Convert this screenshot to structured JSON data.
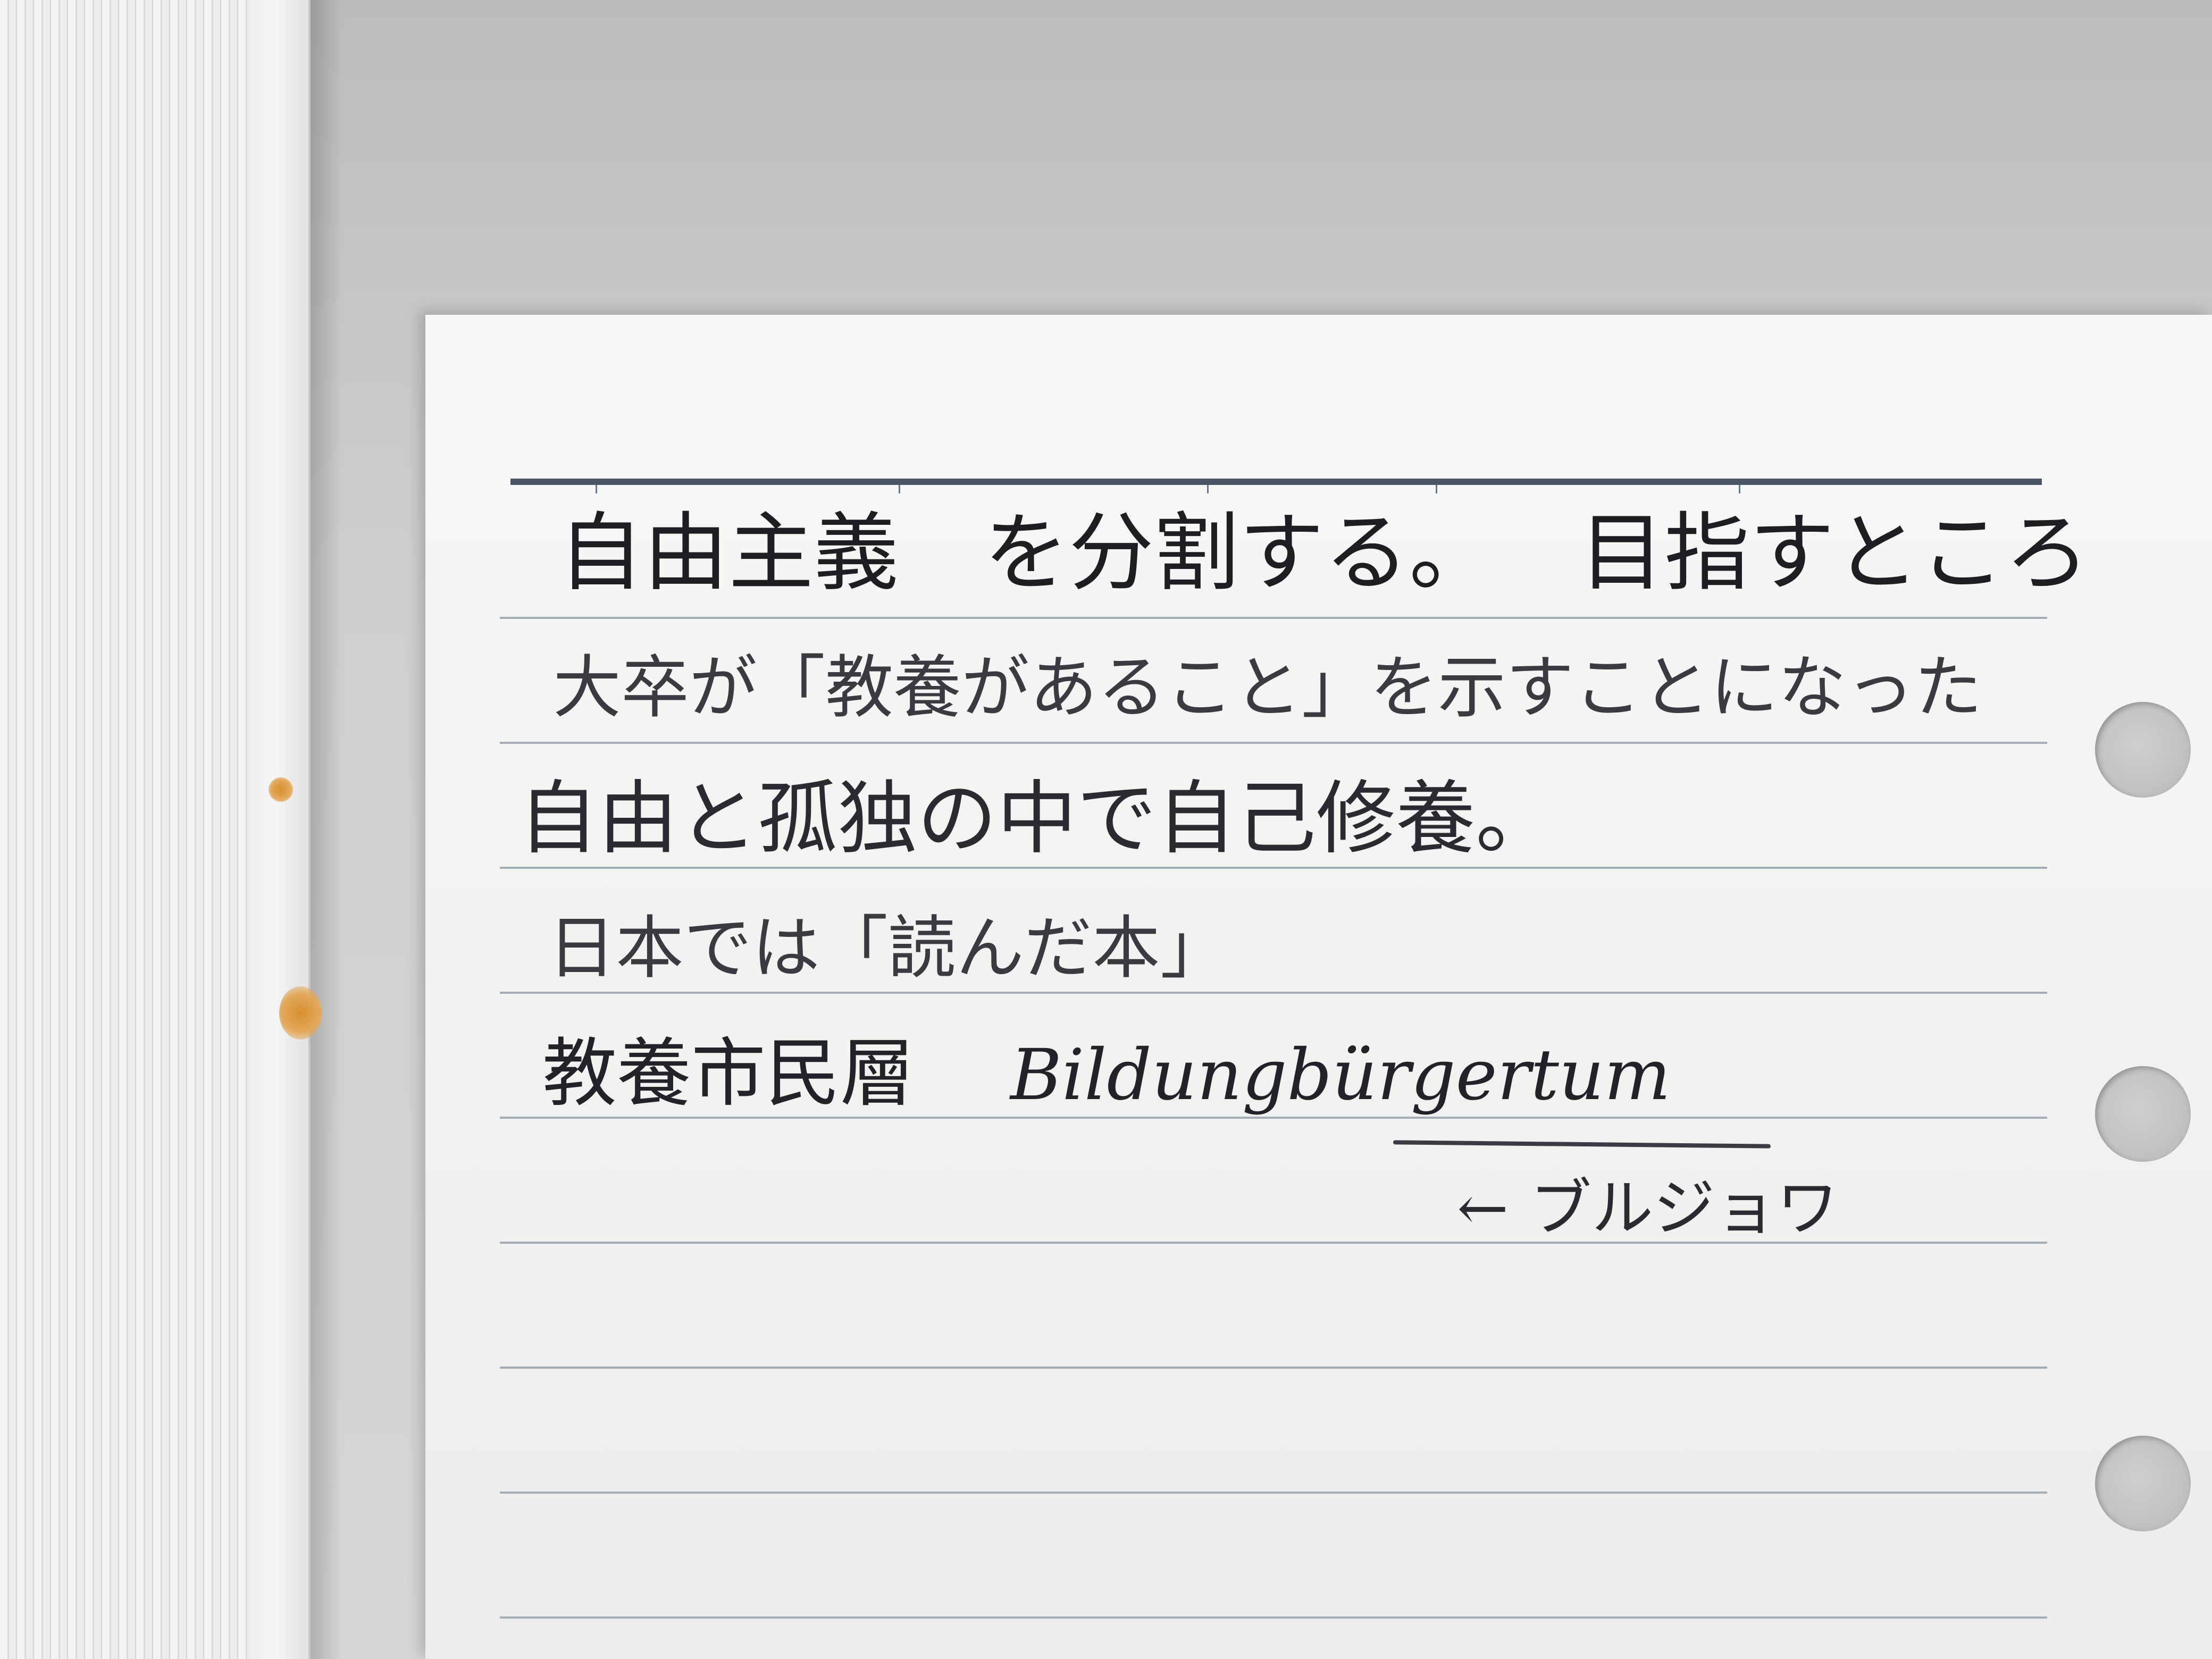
{
  "note": {
    "lines": [
      {
        "left": "自由主義",
        "right": "を分割する。",
        "tail": "目指すところ"
      },
      {
        "text": "大卒が「教養があること」を示すことになった"
      },
      {
        "text": "自由と孤独の中で自己修養。"
      },
      {
        "text": "日本では「読んだ本」"
      },
      {
        "left": "教養市民層",
        "latin": "Bildungbürgertum"
      },
      {
        "arrow": "←",
        "text": "ブルジョワ"
      }
    ]
  }
}
